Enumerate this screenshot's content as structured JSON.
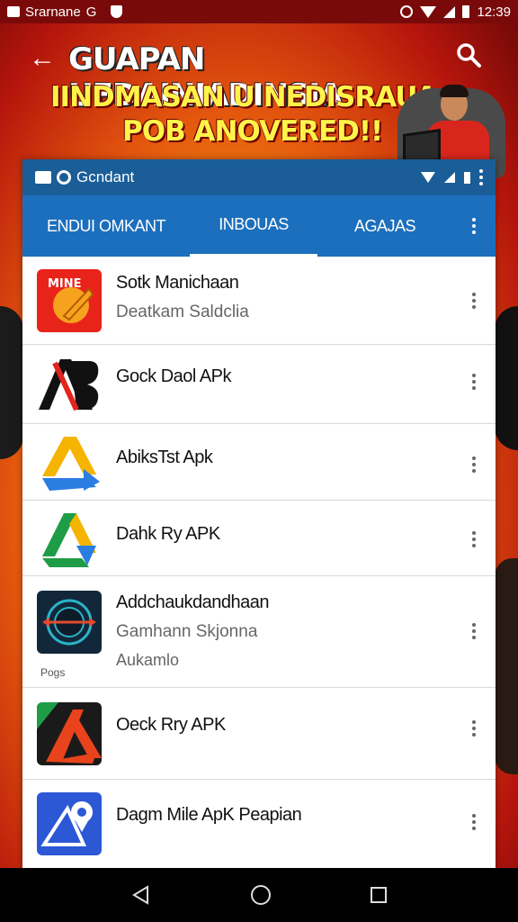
{
  "status_bar": {
    "app_name": "Srarnane",
    "g_label": "G",
    "time": "12:39"
  },
  "banner": {
    "line1": "GUAPAN UFDAINIADINSIA",
    "line2": "IINDMASAN U NEDISRAUA",
    "line3": "POB ANOVERED!!"
  },
  "app_bar": {
    "title": "Gcndant"
  },
  "tabs": [
    {
      "label": "ENDUI OMKANT",
      "active": false
    },
    {
      "label": "INBOUAS",
      "active": true
    },
    {
      "label": "AGAJAS",
      "active": false
    }
  ],
  "apps": [
    {
      "title": "Sotk Manichaan",
      "subtitle": "Deatkam Saldclia",
      "icon": "mine-horn-icon",
      "icon_text": "MINE"
    },
    {
      "title": "Gock Daol APk",
      "icon": "ab-logo-icon"
    },
    {
      "title": "AbiksTst Apk",
      "icon": "drive-arrow-icon"
    },
    {
      "title": "Dahk Ry APK",
      "icon": "drive-triangle-icon"
    },
    {
      "title": "Addchaukdandhaan",
      "subtitle": "Gamhann Skjonna",
      "subtitle2": "Aukamlo",
      "icon": "target-disc-icon",
      "icon_caption": "Pogs"
    },
    {
      "title": "Oeck Rry APK",
      "icon": "red-arrow-icon"
    },
    {
      "title": "Dagm Mile ApK Peapian",
      "icon": "pin-triangle-icon"
    }
  ],
  "colors": {
    "app_bar": "#1a5d97",
    "tab_bar": "#1c6fbd",
    "status_bar": "#7a0a0a"
  }
}
